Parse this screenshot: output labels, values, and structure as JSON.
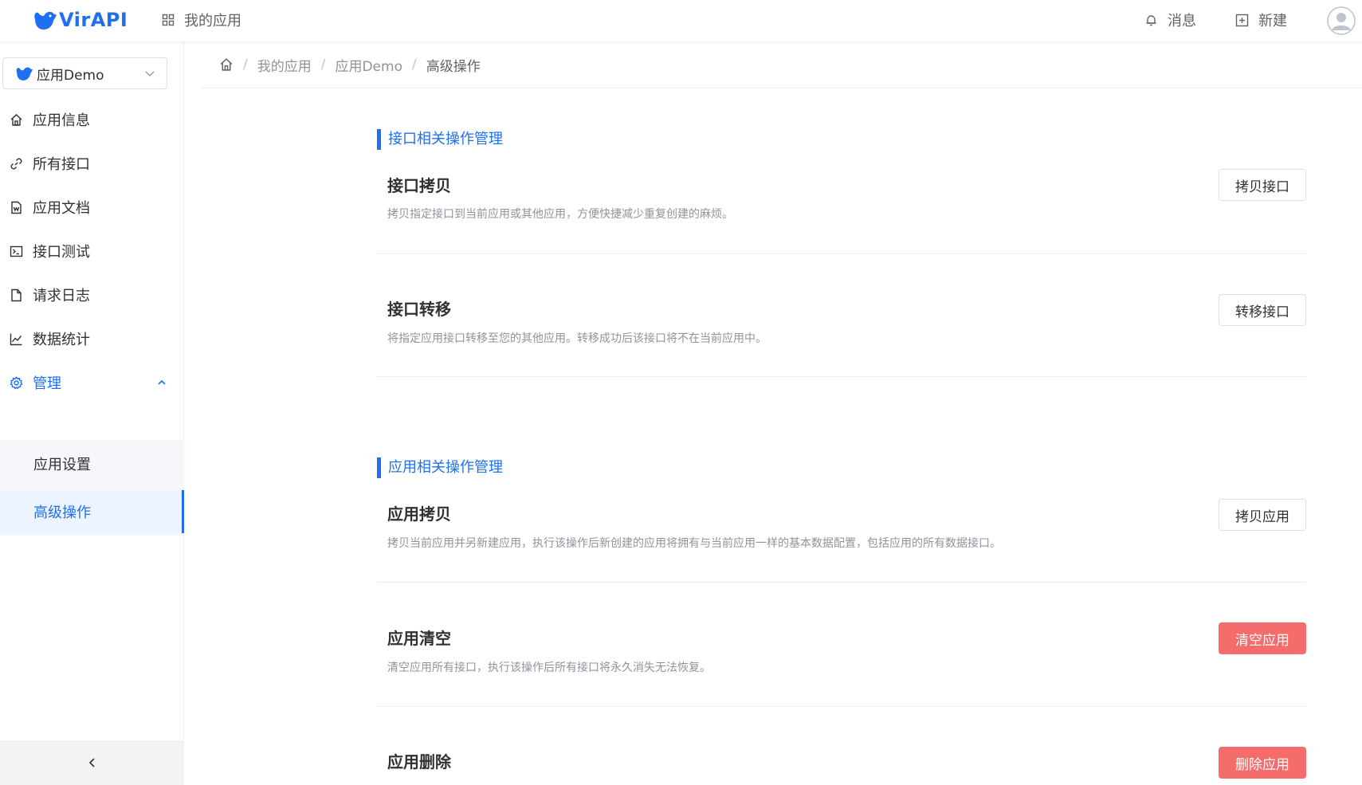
{
  "header": {
    "logo_text": "VirAPI",
    "nav_my_apps": "我的应用",
    "messages": "消息",
    "new": "新建"
  },
  "sidebar": {
    "app_selector": "应用Demo",
    "items": [
      {
        "label": "应用信息",
        "icon": "home-icon"
      },
      {
        "label": "所有接口",
        "icon": "link-icon"
      },
      {
        "label": "应用文档",
        "icon": "document-icon"
      },
      {
        "label": "接口测试",
        "icon": "terminal-icon"
      },
      {
        "label": "请求日志",
        "icon": "file-icon"
      },
      {
        "label": "数据统计",
        "icon": "chart-icon"
      },
      {
        "label": "管理",
        "icon": "gear-icon"
      }
    ],
    "submenu": [
      {
        "label": "应用设置"
      },
      {
        "label": "高级操作"
      }
    ]
  },
  "breadcrumb": [
    "我的应用",
    "应用Demo",
    "高级操作"
  ],
  "sections": [
    {
      "title": "接口相关操作管理",
      "ops": [
        {
          "title": "接口拷贝",
          "desc": "拷贝指定接口到当前应用或其他应用，方便快捷减少重复创建的麻烦。",
          "button": "拷贝接口",
          "danger": false
        },
        {
          "title": "接口转移",
          "desc": "将指定应用接口转移至您的其他应用。转移成功后该接口将不在当前应用中。",
          "button": "转移接口",
          "danger": false
        }
      ]
    },
    {
      "title": "应用相关操作管理",
      "ops": [
        {
          "title": "应用拷贝",
          "desc": "拷贝当前应用并另新建应用，执行该操作后新创建的应用将拥有与当前应用一样的基本数据配置，包括应用的所有数据接口。",
          "button": "拷贝应用",
          "danger": false
        },
        {
          "title": "应用清空",
          "desc": "清空应用所有接口，执行该操作后所有接口将永久消失无法恢复。",
          "button": "清空应用",
          "danger": true
        },
        {
          "title": "应用删除",
          "desc": "",
          "button": "删除应用",
          "danger": true
        }
      ]
    }
  ],
  "colors": {
    "accent": "#1e6ff1",
    "danger": "#f56c6c"
  }
}
